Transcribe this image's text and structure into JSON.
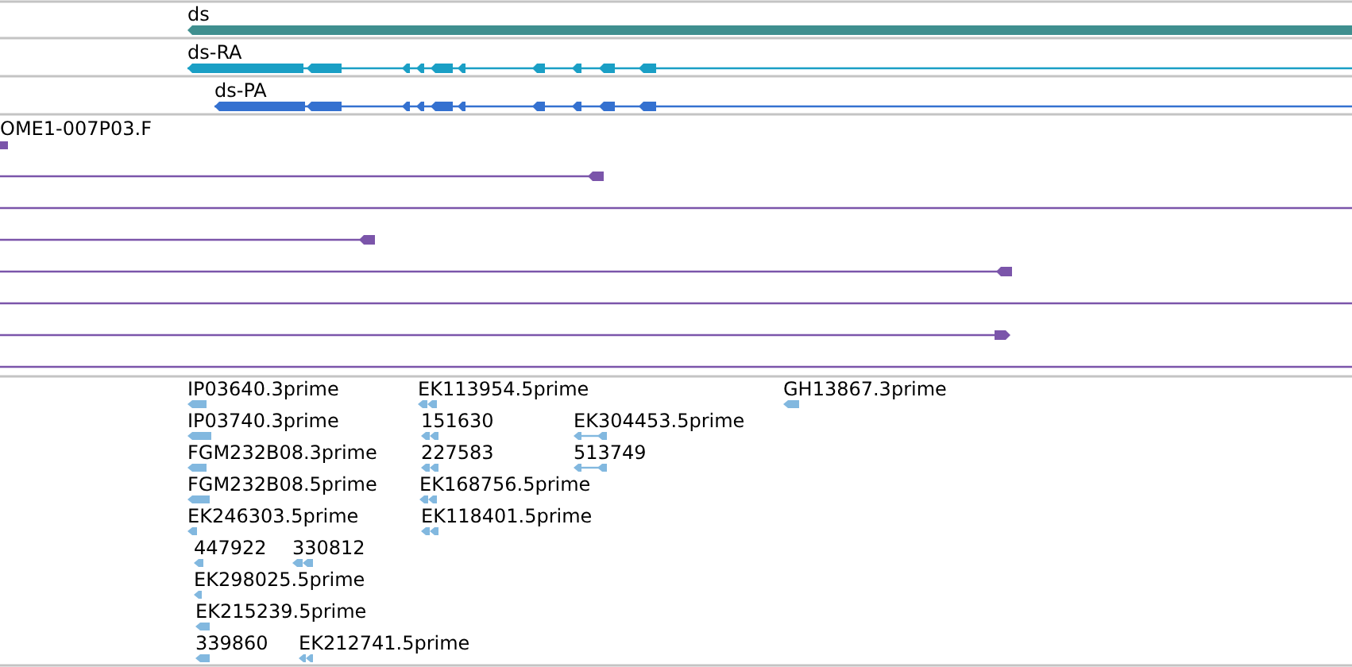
{
  "gene": {
    "label": "ds",
    "reverse": true
  },
  "transcripts": [
    {
      "label": "ds-RA",
      "color": "#1a9fc5"
    },
    {
      "label": "ds-PA",
      "color": "#3471d0"
    }
  ],
  "alignments": {
    "label": "OME1-007P03.F",
    "reads": [
      {
        "kind": "fragment",
        "reverse": true
      },
      {
        "kind": "ended",
        "reverse": true
      },
      {
        "kind": "spanning"
      },
      {
        "kind": "ended",
        "reverse": true
      },
      {
        "kind": "ended",
        "reverse": true
      },
      {
        "kind": "spanning"
      },
      {
        "kind": "ended",
        "reverse": false
      },
      {
        "kind": "spanning"
      }
    ]
  },
  "est_features": [
    {
      "label": "IP03640.3prime"
    },
    {
      "label": "EK113954.5prime"
    },
    {
      "label": "GH13867.3prime"
    },
    {
      "label": "IP03740.3prime"
    },
    {
      "label": "151630"
    },
    {
      "label": "EK304453.5prime"
    },
    {
      "label": "FGM232B08.3prime"
    },
    {
      "label": "227583"
    },
    {
      "label": "513749"
    },
    {
      "label": "FGM232B08.5prime"
    },
    {
      "label": "EK168756.5prime"
    },
    {
      "label": "EK246303.5prime"
    },
    {
      "label": "EK118401.5prime"
    },
    {
      "label": "447922"
    },
    {
      "label": "330812"
    },
    {
      "label": "EK298025.5prime"
    },
    {
      "label": "EK215239.5prime"
    },
    {
      "label": "339860"
    },
    {
      "label": "EK212741.5prime"
    }
  ]
}
